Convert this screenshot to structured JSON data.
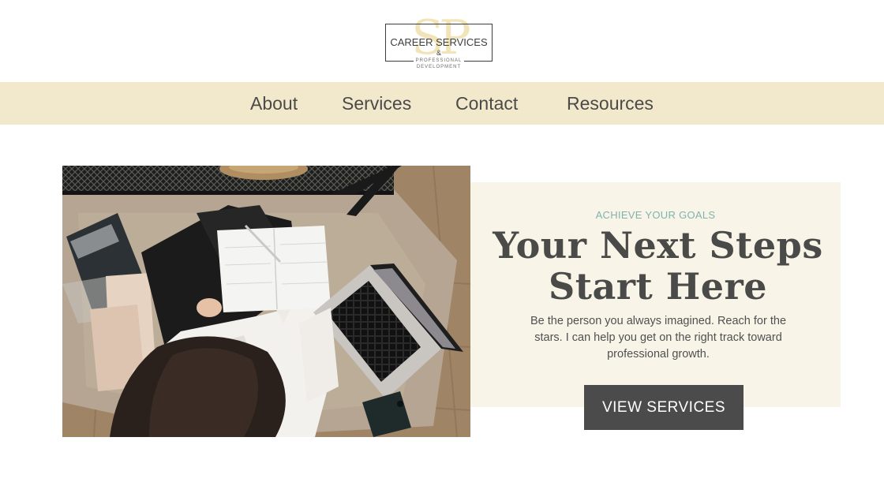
{
  "logo": {
    "monogram": "SP",
    "title": "CAREER SERVICES",
    "amp": "&",
    "subtitle": "PROFESSIONAL DEVELOPMENT"
  },
  "nav": {
    "items": [
      {
        "label": "About"
      },
      {
        "label": "Services"
      },
      {
        "label": "Contact"
      },
      {
        "label": "Resources"
      }
    ]
  },
  "hero": {
    "eyebrow": "ACHIEVE YOUR GOALS",
    "headline_line1": "Your Next Steps",
    "headline_line2": "Start Here",
    "blurb": "Be the person you always imagined. Reach for the stars. I can help you get on the right track toward professional growth.",
    "cta_label": "VIEW SERVICES"
  },
  "colors": {
    "nav_bg": "#f2e9cd",
    "card_bg": "#f8f5e8",
    "accent_teal": "#7fb3ac",
    "button_bg": "#4b4b4b"
  }
}
